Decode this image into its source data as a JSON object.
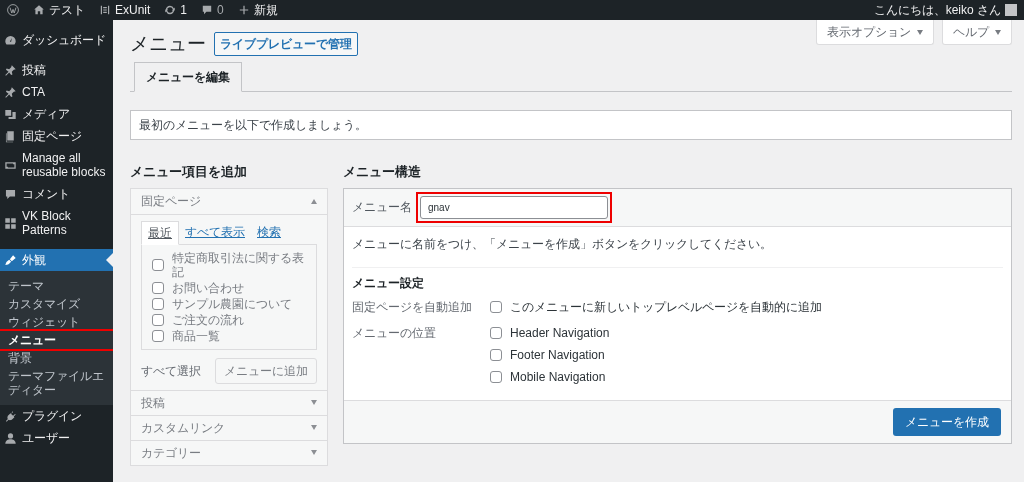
{
  "admin_bar": {
    "items": [
      {
        "kind": "logo"
      },
      {
        "kind": "home",
        "label": "テスト"
      },
      {
        "kind": "exunit",
        "label": "ExUnit"
      },
      {
        "kind": "updates",
        "label": "1"
      },
      {
        "kind": "comments",
        "label": "0"
      },
      {
        "kind": "new",
        "label": "新規"
      }
    ],
    "greeting": "こんにちは、keiko さん"
  },
  "sidebar": {
    "items": [
      {
        "label": "ダッシュボード",
        "kind": "dashboard",
        "selected": false
      },
      {
        "label": "投稿",
        "kind": "pin",
        "selected": false
      },
      {
        "label": "CTA",
        "kind": "pin",
        "selected": false
      },
      {
        "label": "メディア",
        "kind": "media",
        "selected": false
      },
      {
        "label": "固定ページ",
        "kind": "page",
        "selected": false
      },
      {
        "label": "Manage all reusable blocks",
        "kind": "reuse",
        "selected": false
      },
      {
        "label": "コメント",
        "kind": "comment",
        "selected": false
      },
      {
        "label": "VK Block Patterns",
        "kind": "grid",
        "selected": false
      },
      {
        "label": "外観",
        "kind": "brush",
        "selected": true,
        "children": [
          {
            "label": "テーマ",
            "selected": false,
            "highlighted": false
          },
          {
            "label": "カスタマイズ",
            "selected": false,
            "highlighted": false
          },
          {
            "label": "ウィジェット",
            "selected": false,
            "highlighted": false
          },
          {
            "label": "メニュー",
            "selected": true,
            "highlighted": true
          },
          {
            "label": "背景",
            "selected": false,
            "highlighted": false
          },
          {
            "label": "テーマファイルエディター",
            "selected": false,
            "highlighted": false
          }
        ]
      },
      {
        "label": "プラグイン",
        "kind": "plug",
        "selected": false
      },
      {
        "label": "ユーザー",
        "kind": "user",
        "selected": false
      }
    ]
  },
  "top_buttons": [
    {
      "label": "表示オプション"
    },
    {
      "label": "ヘルプ"
    }
  ],
  "page_title": "メニュー",
  "live_preview_button": "ライブプレビューで管理",
  "tabs": [
    {
      "label": "メニューを編集",
      "selected": true
    }
  ],
  "notice": "最初のメニューを以下で作成しましょう。",
  "add_items": {
    "heading": "メニュー項目を追加",
    "disabled": true,
    "sections": [
      {
        "title": "固定ページ",
        "expanded": true,
        "tabs": [
          {
            "label": "最近",
            "selected": true
          },
          {
            "label": "すべて表示",
            "selected": false
          },
          {
            "label": "検索",
            "selected": false
          }
        ],
        "items": [
          {
            "label": "特定商取引法に関する表記",
            "checked": false
          },
          {
            "label": "お問い合わせ",
            "checked": false
          },
          {
            "label": "サンプル農園について",
            "checked": false
          },
          {
            "label": "ご注文の流れ",
            "checked": false
          },
          {
            "label": "商品一覧",
            "checked": false
          }
        ],
        "select_all": "すべて選択",
        "add_button": "メニューに追加"
      },
      {
        "title": "投稿",
        "expanded": false
      },
      {
        "title": "カスタムリンク",
        "expanded": false
      },
      {
        "title": "カテゴリー",
        "expanded": false
      }
    ]
  },
  "menu_structure": {
    "heading": "メニュー構造",
    "name_label": "メニュー名",
    "name_value": "gnav",
    "name_highlighted": true,
    "instructions": "メニューに名前をつけ、「メニューを作成」ボタンをクリックしてください。",
    "settings_heading": "メニュー設定",
    "settings": [
      {
        "label": "固定ページを自動追加",
        "options": [
          {
            "label": "このメニューに新しいトップレベルページを自動的に追加",
            "checked": false
          }
        ]
      },
      {
        "label": "メニューの位置",
        "options": [
          {
            "label": "Header Navigation",
            "checked": false
          },
          {
            "label": "Footer Navigation",
            "checked": false
          },
          {
            "label": "Mobile Navigation",
            "checked": false
          }
        ]
      }
    ],
    "create_button": "メニューを作成"
  }
}
